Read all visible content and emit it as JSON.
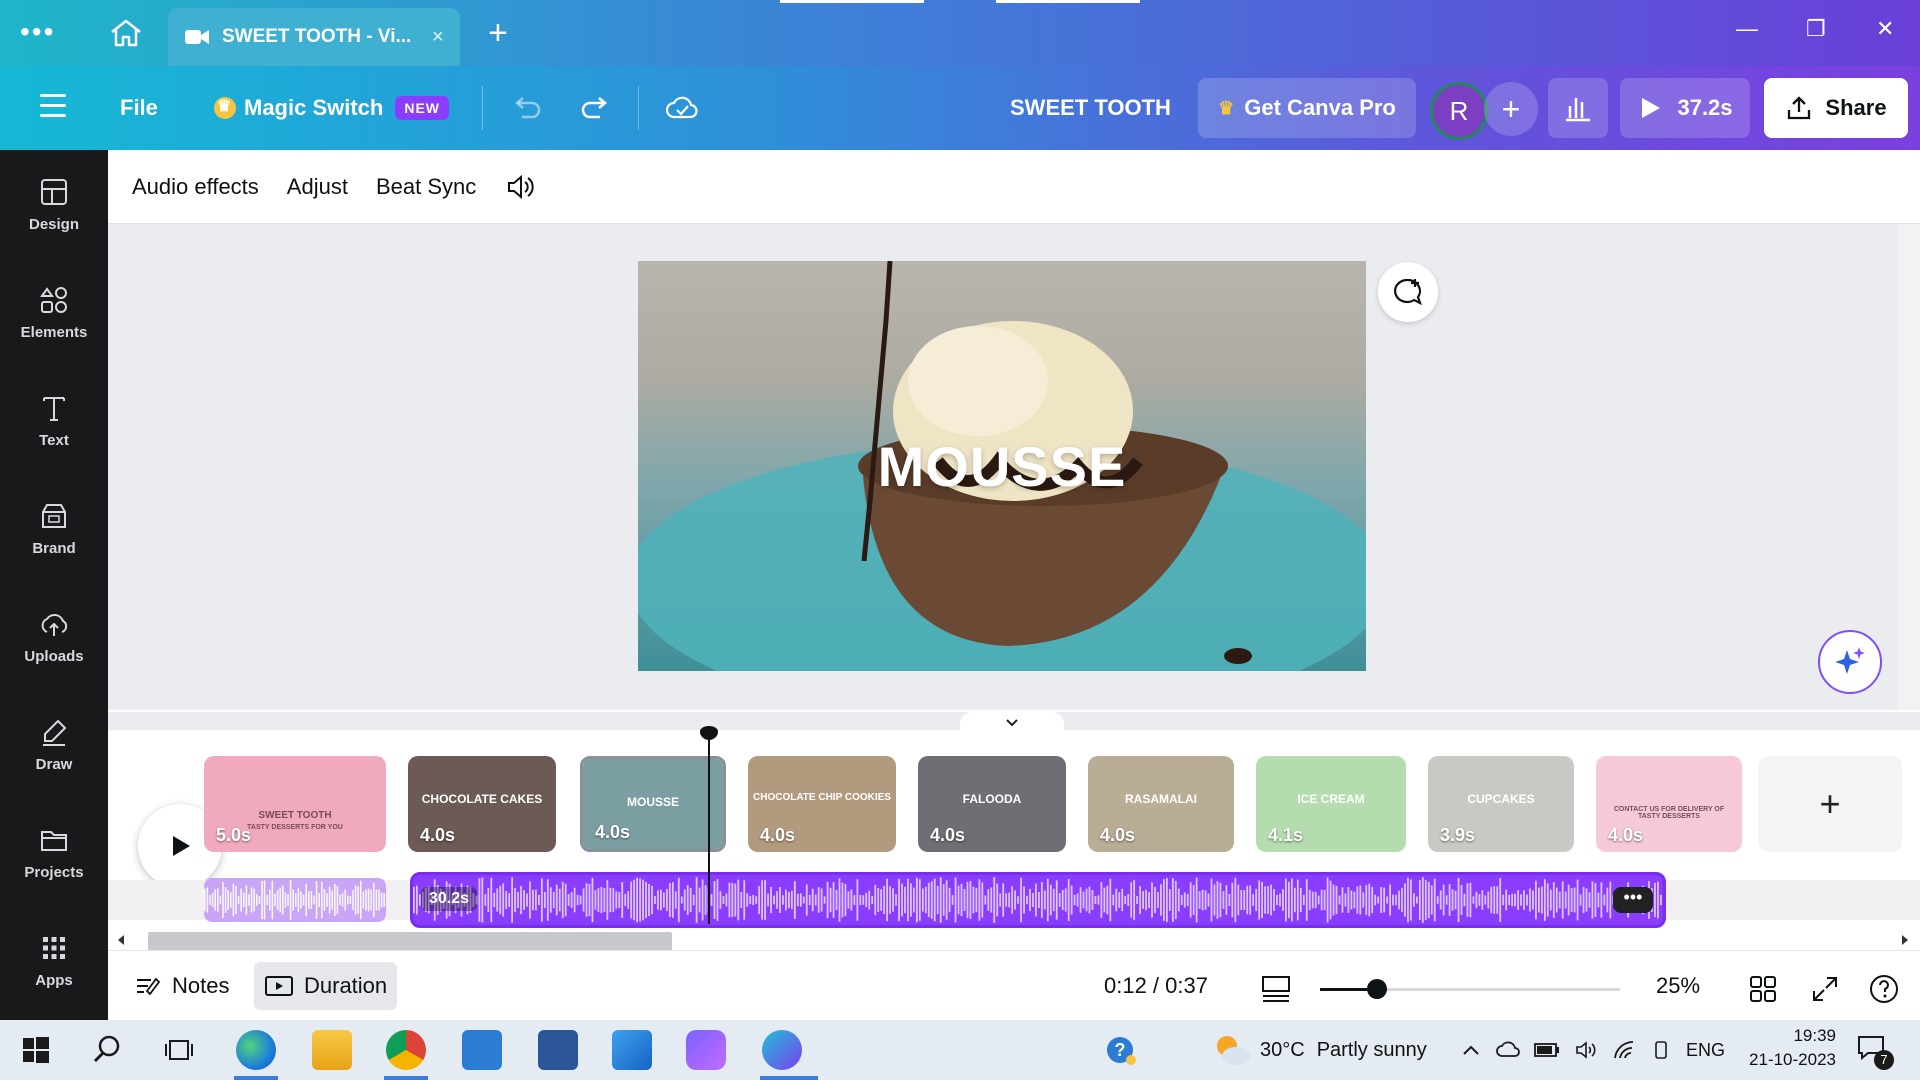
{
  "browser": {
    "tab_title": "SWEET TOOTH - Vi...",
    "tab_close": "×",
    "new_tab": "+",
    "menu_dots": "•••",
    "window_controls": {
      "minimize": "—",
      "restore": "❐",
      "close": "✕"
    }
  },
  "header": {
    "file_label": "File",
    "magic_switch_label": "Magic Switch",
    "new_badge": "NEW",
    "project_title": "SWEET TOOTH",
    "get_pro_label": "Get Canva Pro",
    "avatar_initial": "R",
    "add_people": "+",
    "present_duration": "37.2s",
    "share_label": "Share"
  },
  "sidebar": {
    "items": [
      {
        "label": "Design",
        "icon": "layout-icon"
      },
      {
        "label": "Elements",
        "icon": "shapes-icon"
      },
      {
        "label": "Text",
        "icon": "text-icon"
      },
      {
        "label": "Brand",
        "icon": "brand-icon"
      },
      {
        "label": "Uploads",
        "icon": "cloud-upload-icon"
      },
      {
        "label": "Draw",
        "icon": "pen-icon"
      },
      {
        "label": "Projects",
        "icon": "folder-icon"
      },
      {
        "label": "Apps",
        "icon": "grid-icon"
      }
    ]
  },
  "context_toolbar": {
    "audio_effects": "Audio effects",
    "adjust": "Adjust",
    "beat_sync": "Beat Sync"
  },
  "canvas": {
    "title": "MOUSSE"
  },
  "timeline": {
    "clips": [
      {
        "label": "SWEET TOOTH",
        "sublabel": "TASTY DESSERTS FOR YOU",
        "duration": "5.0s",
        "color": "#f0a9bd"
      },
      {
        "label": "CHOCOLATE CAKES",
        "duration": "4.0s",
        "color": "#6b5a55"
      },
      {
        "label": "MOUSSE",
        "duration": "4.0s",
        "color": "#7b9ea3",
        "selected": true
      },
      {
        "label": "CHOCOLATE CHIP COOKIES",
        "duration": "4.0s",
        "color": "#b29a7e"
      },
      {
        "label": "FALOODA",
        "duration": "4.0s",
        "color": "#6e6e74"
      },
      {
        "label": "RASAMALAI",
        "duration": "4.0s",
        "color": "#b9ad95"
      },
      {
        "label": "ICE CREAM",
        "duration": "4.1s",
        "color": "#b5dcae"
      },
      {
        "label": "CUPCAKES",
        "duration": "3.9s",
        "color": "#c9c9c4"
      },
      {
        "label": "CONTACT US FOR DELIVERY OF TASTY DESSERTS",
        "duration": "4.0s",
        "color": "#f6c9d8"
      }
    ],
    "add_clip": "+",
    "audio_duration": "30.2s",
    "audio_more": "•••"
  },
  "bottom_bar": {
    "notes_label": "Notes",
    "duration_label": "Duration",
    "time_readout": "0:12 / 0:37",
    "zoom_level": 0.19,
    "zoom_percent": "25%"
  },
  "taskbar": {
    "temperature": "30°C",
    "weather": "Partly sunny",
    "language": "ENG",
    "time": "19:39",
    "date": "21-10-2023",
    "notifications": "7"
  },
  "colors": {
    "accent_purple": "#8b3dff",
    "header_start": "#15b9d6",
    "header_end": "#7b3fe0",
    "rail_bg": "#18191b"
  }
}
